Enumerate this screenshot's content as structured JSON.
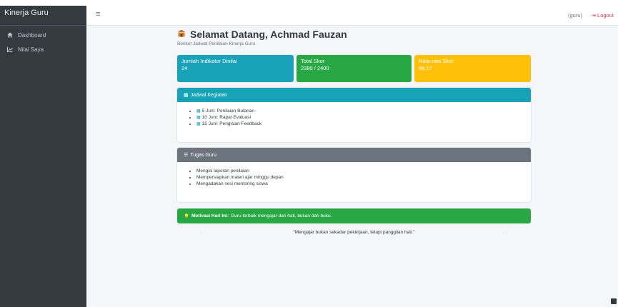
{
  "brand": "Kinerja Guru",
  "sidebar": {
    "items": [
      {
        "label": "Dashboard",
        "icon": "home-icon"
      },
      {
        "label": "Nilai Saya",
        "icon": "chart-line-icon"
      }
    ]
  },
  "navbar": {
    "menu_icon": "hamburger-icon",
    "user": "(guru)",
    "logout": "Logout"
  },
  "page": {
    "title": "Selamat Datang, Achmad Fauzan",
    "subtitle": "Berikut Jadwal Penilaian Kinerja Guru"
  },
  "stats": [
    {
      "label": "Jumlah Indikator Dinilai",
      "value": "24",
      "color": "#17a2b8"
    },
    {
      "label": "Total Skor",
      "value": "2380 / 2400",
      "color": "#28a745"
    },
    {
      "label": "Rata-rata Skor",
      "value": "99.17",
      "color": "#ffc107"
    }
  ],
  "jadwal": {
    "title": "Jadwal Kegiatan",
    "color": "#17a2b8",
    "items": [
      "5 Juni: Penilaian Bulanan",
      "10 Juni: Rapat Evaluasi",
      "15 Juni: Pengisian Feedback"
    ]
  },
  "tugas": {
    "title": "Tugas Guru",
    "color": "#6c757d",
    "items": [
      "Mengisi laporan penilaian",
      "Mempersiapkan materi ajar minggu depan",
      "Mengadakan sesi mentoring siswa"
    ]
  },
  "motivasi": {
    "label": "Motivasi Hari Ini:",
    "text": "Guru terbaik mengajar dari hati, bukan dari buku."
  },
  "quote": "\"Mengajar bukan sekadar pekerjaan, tetapi panggilan hati.\""
}
